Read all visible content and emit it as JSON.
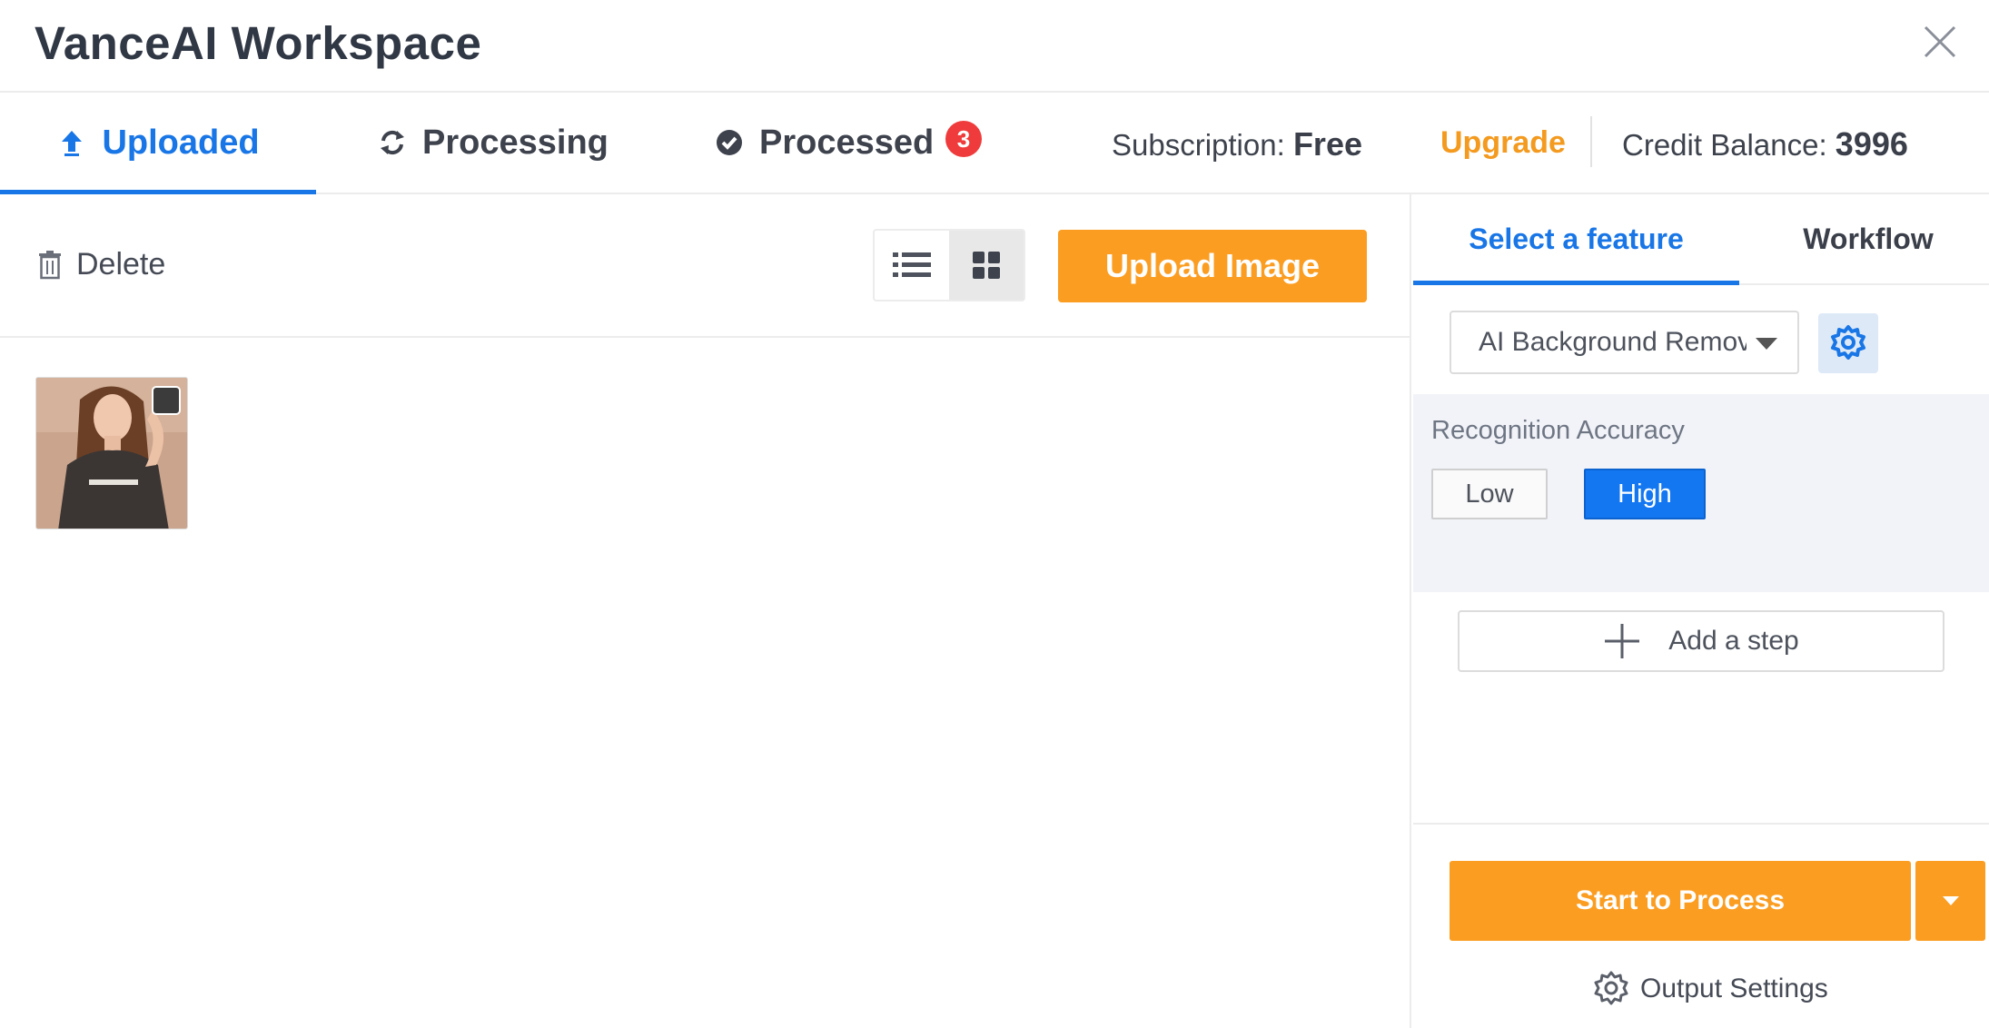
{
  "app": {
    "title": "VanceAI Workspace"
  },
  "tabs": [
    {
      "label": "Uploaded",
      "icon": "upload-arrow-icon",
      "active": true
    },
    {
      "label": "Processing",
      "icon": "refresh-icon",
      "active": false
    },
    {
      "label": "Processed",
      "icon": "check-circle-icon",
      "active": false,
      "badge": "3"
    }
  ],
  "account": {
    "subscription_label": "Subscription:",
    "subscription_value": "Free",
    "upgrade_label": "Upgrade",
    "credit_label": "Credit Balance:",
    "credit_value": "3996"
  },
  "toolbar": {
    "delete_label": "Delete",
    "view_modes": [
      "list",
      "grid"
    ],
    "active_view": "grid",
    "upload_label": "Upload Image"
  },
  "images": [
    {
      "checked": true
    }
  ],
  "side": {
    "tabs": [
      {
        "label": "Select a feature",
        "active": true
      },
      {
        "label": "Workflow",
        "active": false
      }
    ],
    "feature_selected": "AI Background Remover",
    "accuracy_label": "Recognition Accuracy",
    "accuracy_options": [
      "Low",
      "High"
    ],
    "accuracy_selected": "High",
    "add_step_label": "Add a step",
    "start_label": "Start to Process",
    "output_settings_label": "Output Settings"
  },
  "colors": {
    "accent_blue": "#1976e6",
    "accent_orange": "#fb9d21",
    "badge_red": "#ef3b3b"
  }
}
